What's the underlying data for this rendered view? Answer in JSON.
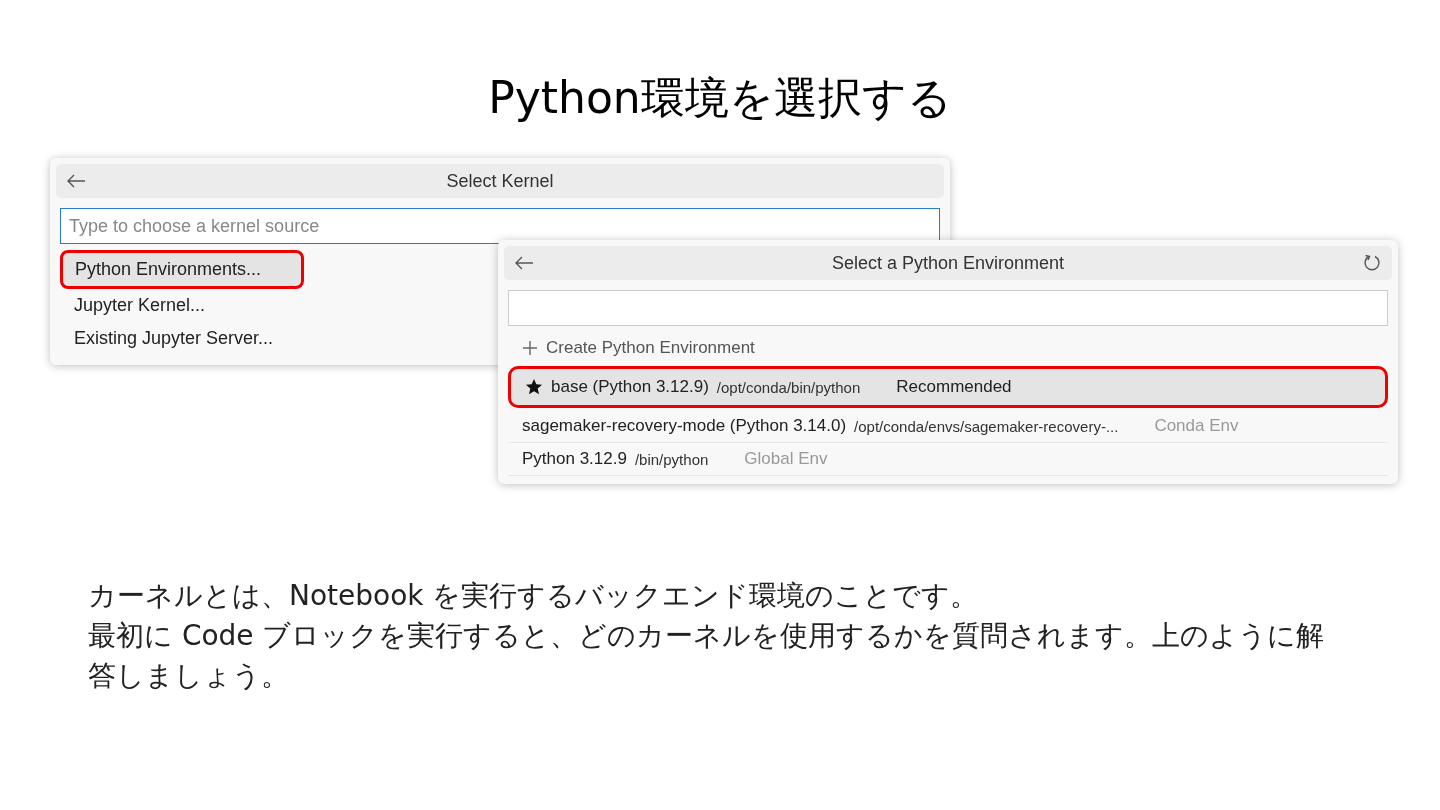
{
  "title": "Python環境を選択する",
  "kernel_picker": {
    "title": "Select Kernel",
    "placeholder": "Type to choose a kernel source",
    "items": [
      {
        "label": "Python Environments...",
        "selected": true
      },
      {
        "label": "Jupyter Kernel...",
        "selected": false
      },
      {
        "label": "Existing Jupyter Server...",
        "selected": false
      }
    ]
  },
  "environment_picker": {
    "title": "Select a Python Environment",
    "items": [
      {
        "kind": "action",
        "label": "Create Python Environment"
      },
      {
        "kind": "env",
        "starred": true,
        "name": "base (Python 3.12.9)",
        "path": "/opt/conda/bin/python",
        "tag": "Recommended",
        "selected": true
      },
      {
        "kind": "env",
        "starred": false,
        "name": "sagemaker-recovery-mode (Python 3.14.0)",
        "path": "/opt/conda/envs/sagemaker-recovery-...",
        "tag": "Conda Env",
        "selected": false
      },
      {
        "kind": "env",
        "starred": false,
        "name": "Python 3.12.9",
        "path": "/bin/python",
        "tag": "Global Env",
        "selected": false
      }
    ]
  },
  "caption": [
    "カーネルとは、Notebook を実行するバックエンド環境のことです。",
    "最初に Code ブロックを実行すると、どのカーネルを使用するかを質問されます。上のように解答しましょう。"
  ]
}
